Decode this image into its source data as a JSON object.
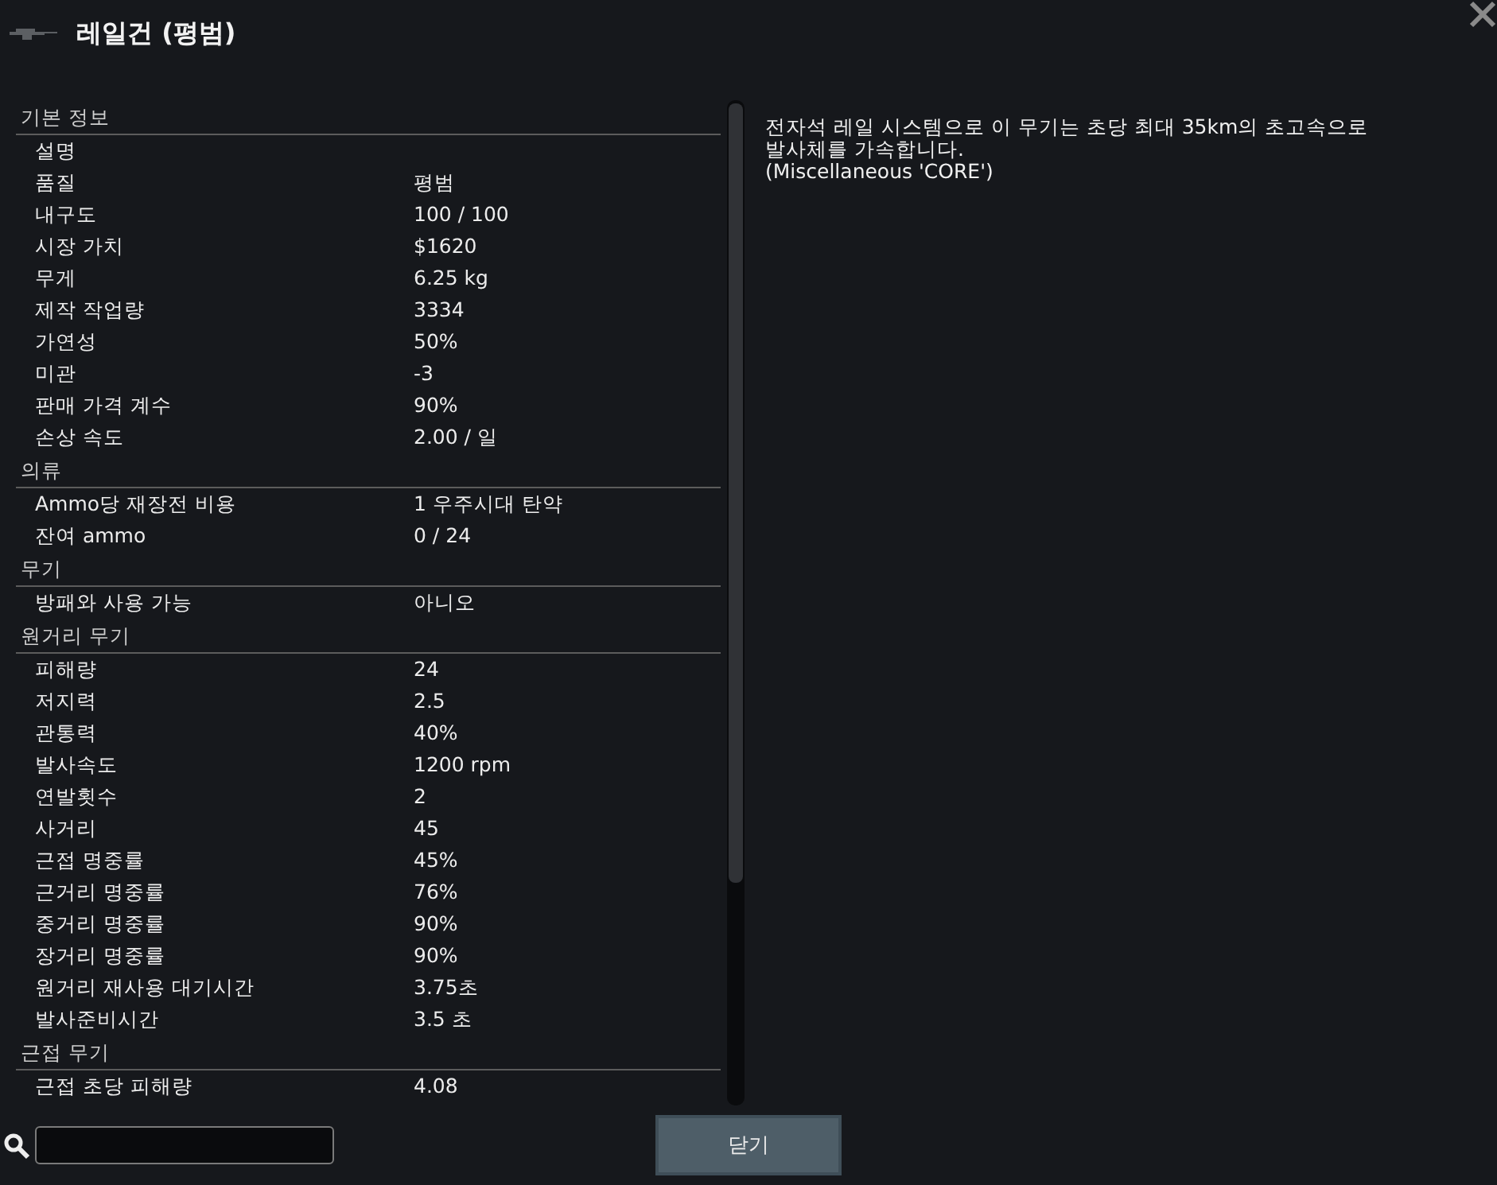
{
  "window": {
    "title": "레일건 (평범)"
  },
  "sections": [
    {
      "title": "기본 정보",
      "rows": [
        {
          "label": "설명"
        },
        {
          "label": "품질",
          "value": "평범"
        },
        {
          "label": "내구도",
          "value": "100 / 100"
        },
        {
          "label": "시장 가치",
          "value": "$1620"
        },
        {
          "label": "무게",
          "value": "6.25 kg"
        },
        {
          "label": "제작 작업량",
          "value": "3334"
        },
        {
          "label": "가연성",
          "value": "50%"
        },
        {
          "label": "미관",
          "value": "-3"
        },
        {
          "label": "판매 가격 계수",
          "value": "90%"
        },
        {
          "label": "손상 속도",
          "value": "2.00 / 일"
        }
      ]
    },
    {
      "title": "의류",
      "rows": [
        {
          "label": "Ammo당 재장전 비용",
          "value": "1 우주시대 탄약"
        },
        {
          "label": "잔여 ammo",
          "value": "0 / 24"
        }
      ]
    },
    {
      "title": "무기",
      "rows": [
        {
          "label": "방패와 사용 가능",
          "value": "아니오"
        }
      ]
    },
    {
      "title": "원거리 무기",
      "rows": [
        {
          "label": "피해량",
          "value": "24"
        },
        {
          "label": "저지력",
          "value": "2.5"
        },
        {
          "label": "관통력",
          "value": "40%"
        },
        {
          "label": "발사속도",
          "value": "1200 rpm"
        },
        {
          "label": "연발횟수",
          "value": "2"
        },
        {
          "label": "사거리",
          "value": "45"
        },
        {
          "label": "근접 명중률",
          "value": "45%"
        },
        {
          "label": "근거리 명중률",
          "value": "76%"
        },
        {
          "label": "중거리 명중률",
          "value": "90%"
        },
        {
          "label": "장거리 명중률",
          "value": "90%"
        },
        {
          "label": "원거리 재사용 대기시간",
          "value": "3.75초"
        },
        {
          "label": "발사준비시간",
          "value": "3.5 초"
        }
      ]
    },
    {
      "title": "근접 무기",
      "rows": [
        {
          "label": "근접 초당 피해량",
          "value": "4.08"
        }
      ]
    }
  ],
  "description": [
    "전자석 레일 시스템으로 이 무기는 초당 최대 35km의 초고속으로 발사체를 가속합니다.",
    "(Miscellaneous 'CORE')"
  ],
  "close_button": "닫기"
}
